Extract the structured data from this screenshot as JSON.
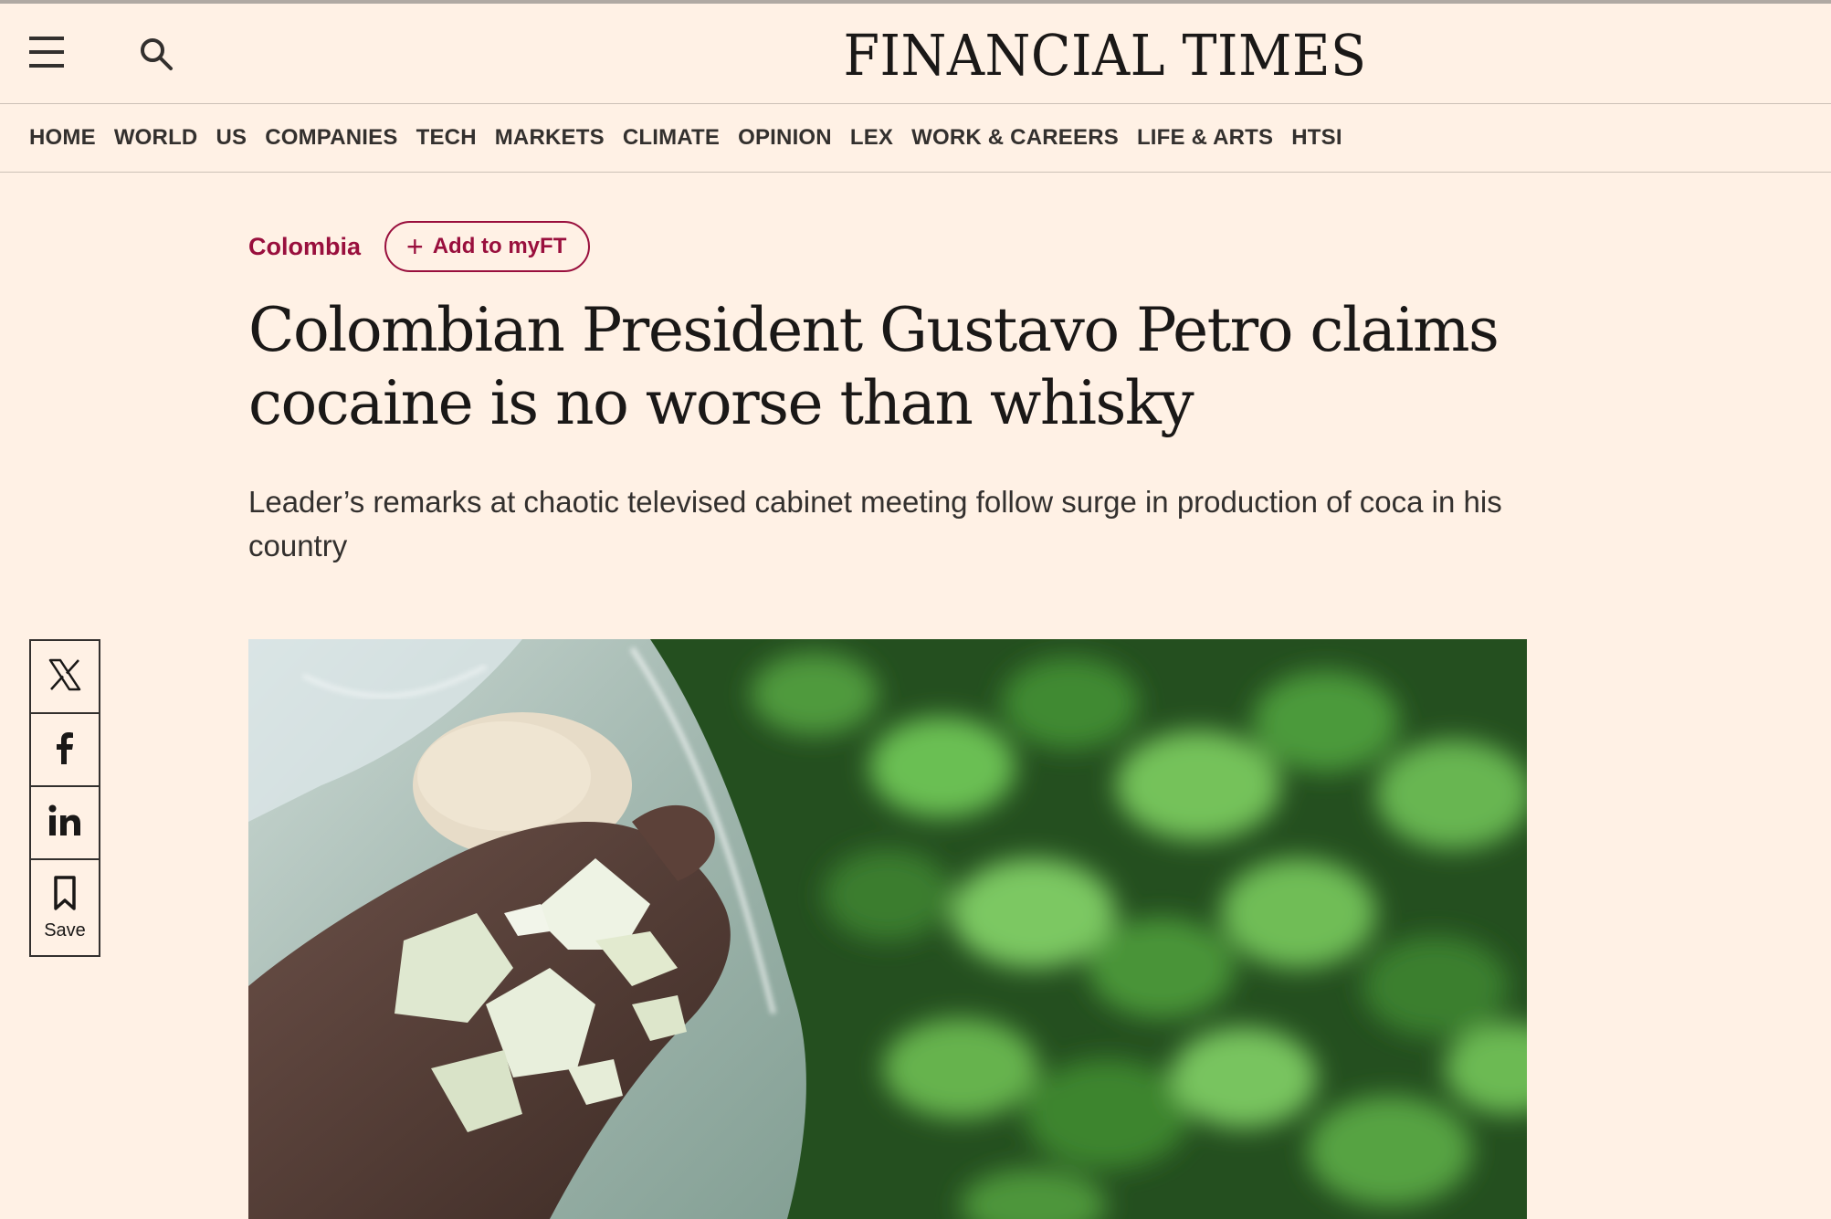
{
  "masthead": {
    "logo": "FINANCIAL TIMES",
    "menu_icon": "hamburger-menu-icon",
    "search_icon": "search-icon"
  },
  "nav": {
    "items": [
      {
        "label": "HOME"
      },
      {
        "label": "WORLD"
      },
      {
        "label": "US"
      },
      {
        "label": "COMPANIES"
      },
      {
        "label": "TECH"
      },
      {
        "label": "MARKETS"
      },
      {
        "label": "CLIMATE"
      },
      {
        "label": "OPINION"
      },
      {
        "label": "LEX"
      },
      {
        "label": "WORK & CAREERS"
      },
      {
        "label": "LIFE & ARTS"
      },
      {
        "label": "HTSI"
      }
    ]
  },
  "article": {
    "topic": "Colombia",
    "myft_button": "Add to myFT",
    "headline": "Colombian President Gustavo Petro claims cocaine is no worse than whisky",
    "standfirst": "Leader’s remarks at chaotic televised cabinet meeting follow surge in production of coca in his country"
  },
  "share": {
    "items": [
      {
        "icon": "x-twitter-icon"
      },
      {
        "icon": "facebook-icon"
      },
      {
        "icon": "linkedin-icon"
      },
      {
        "icon": "bookmark-icon",
        "label": "Save"
      }
    ]
  },
  "colors": {
    "background": "#fff1e5",
    "accent": "#990f3d",
    "text": "#33302e"
  }
}
